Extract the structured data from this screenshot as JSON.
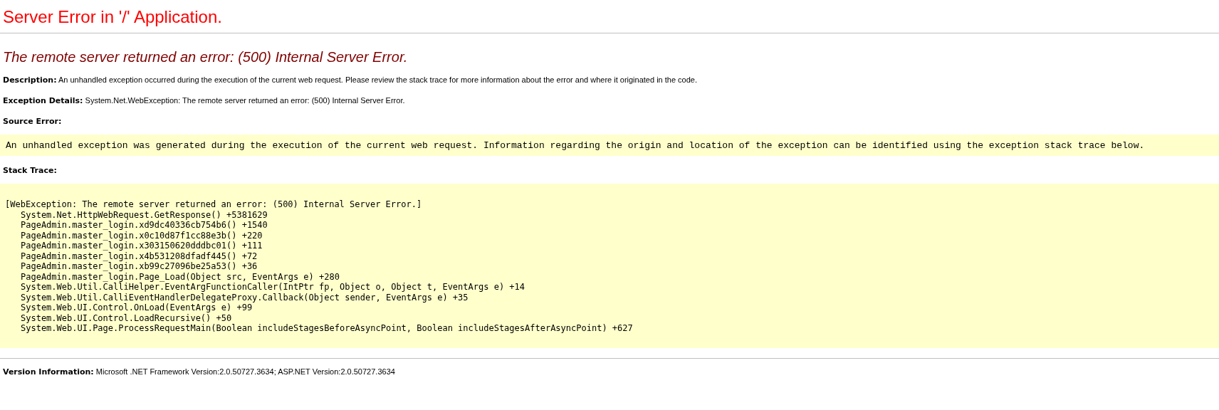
{
  "title": "Server Error in '/' Application.",
  "heading": "The remote server returned an error: (500) Internal Server Error.",
  "description": "**Description:** An unhandled exception occurred during the execution of the current web request. Please review the stack trace for more information about the error and where it originated in the code.",
  "exception_details": "**Exception Details:** System.Net.WebException: The remote server returned an error: (500) Internal Server Error.",
  "source_error": {
    "label": "Source Error:",
    "message": "An unhandled exception was generated during the execution of the current web request. Information regarding the origin and location of the exception can be identified using the exception stack trace below."
  },
  "stack_trace": {
    "label": "Stack Trace:",
    "lines": [
      {
        "kind": "header",
        "text": "[WebException: The remote server returned an error: (500) Internal Server Error.]"
      },
      {
        "kind": "frame",
        "text": "System.Net.HttpWebRequest.GetResponse() +5381629"
      },
      {
        "kind": "frame",
        "text": "PageAdmin.master_login.xd9dc40336cb754b6() +1540"
      },
      {
        "kind": "frame",
        "text": "PageAdmin.master_login.x0c10d87f1cc88e3b() +220"
      },
      {
        "kind": "frame",
        "text": "PageAdmin.master_login.x303150620dddbc01() +111"
      },
      {
        "kind": "frame",
        "text": "PageAdmin.master_login.x4b531208dfadf445() +72"
      },
      {
        "kind": "frame",
        "text": "PageAdmin.master_login.xb99c27096be25a53() +36"
      },
      {
        "kind": "frame",
        "text": "PageAdmin.master_login.Page_Load(Object src, EventArgs e) +280"
      },
      {
        "kind": "frame",
        "text": "System.Web.Util.CalliHelper.EventArgFunctionCaller(IntPtr fp, Object o, Object t, EventArgs e) +14"
      },
      {
        "kind": "frame",
        "text": "System.Web.Util.CalliEventHandlerDelegateProxy.Callback(Object sender, EventArgs e) +35"
      },
      {
        "kind": "frame",
        "text": "System.Web.UI.Control.OnLoad(EventArgs e) +99"
      },
      {
        "kind": "frame",
        "text": "System.Web.UI.Control.LoadRecursive() +50"
      },
      {
        "kind": "frame",
        "text": "System.Web.UI.Page.ProcessRequestMain(Boolean includeStagesBeforeAsyncPoint, Boolean includeStagesAfterAsyncPoint) +627"
      }
    ]
  },
  "version_information": "**Version Information:** Microsoft .NET Framework Version:2.0.50727.3634; ASP.NET Version:2.0.50727.3634"
}
